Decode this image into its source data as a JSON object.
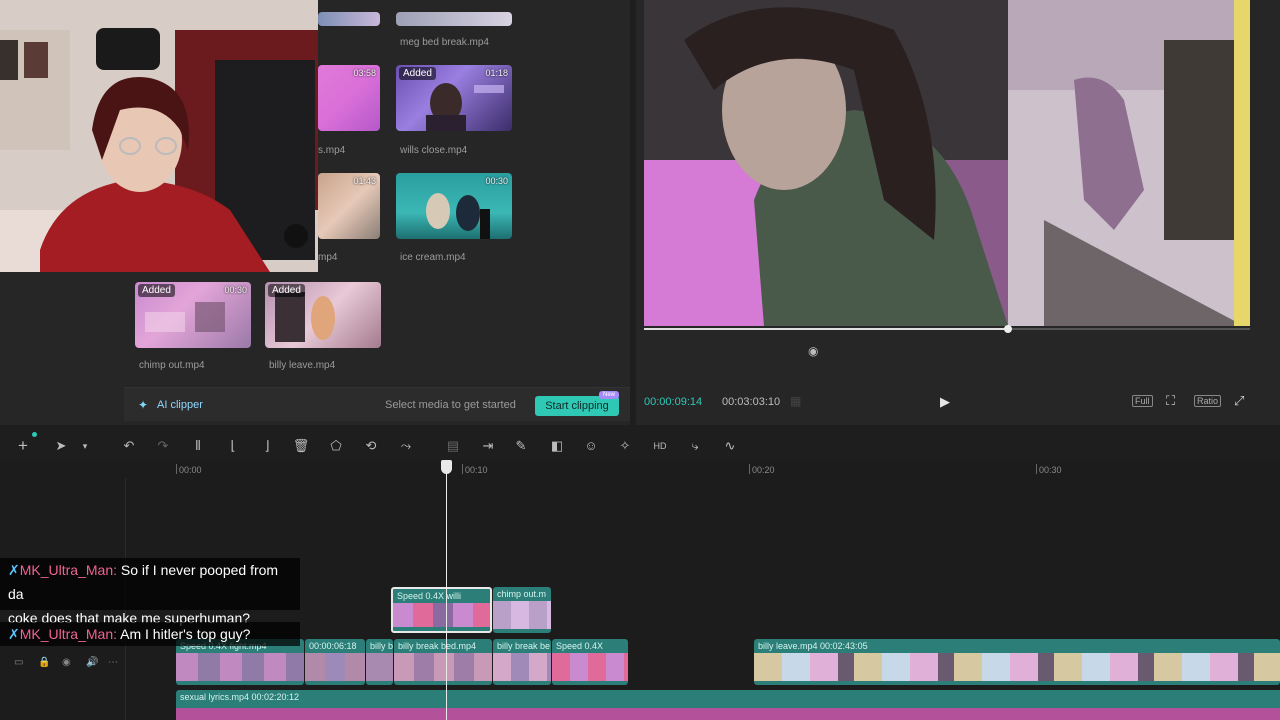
{
  "media": {
    "items": [
      {
        "name": "meg bed break.mp4",
        "added": false,
        "duration": ""
      },
      {
        "name": "s.mp4",
        "added": false,
        "duration": "03:58"
      },
      {
        "name": "wills close.mp4",
        "added": true,
        "duration": "01:18"
      },
      {
        "name": "mp4",
        "added": false,
        "duration": "01:43"
      },
      {
        "name": "ice cream.mp4",
        "added": false,
        "duration": "00:30"
      },
      {
        "name": "chimp out.mp4",
        "added": true,
        "duration": "00:30"
      },
      {
        "name": "billy leave.mp4",
        "added": true,
        "duration": ""
      }
    ],
    "added_label": "Added"
  },
  "ai_clipper": {
    "label": "AI clipper",
    "hint": "Select media to get started",
    "button": "Start clipping",
    "new_tag": "New"
  },
  "preview": {
    "current_time": "00:00:09:14",
    "total_time": "00:03:03:10",
    "full_label": "Full",
    "ratio_label": "Ratio",
    "progress": 0.6
  },
  "ruler": {
    "labels": [
      "00:00",
      "00:10",
      "00:20",
      "00:30"
    ]
  },
  "tracks": {
    "upper": [
      {
        "label": "Speed 0.4X  willi"
      },
      {
        "label": "chimp out.m"
      }
    ],
    "main": [
      {
        "label": "Speed 0.4X  fight.mp4"
      },
      {
        "label": "00:00:06:18"
      },
      {
        "label": "billy b"
      },
      {
        "label": "billy break bed.mp4"
      },
      {
        "label": "billy break be"
      },
      {
        "label": "Speed 0.4X"
      },
      {
        "label": "billy leave.mp4   00:02:43:05"
      }
    ],
    "audio": {
      "label": "sexual lyrics.mp4   00:02:20:12"
    }
  },
  "chat": {
    "messages": [
      {
        "user": "MK_Ultra_Man:",
        "text": "So if I never pooped from da",
        "text2": "coke does that make me superhuman?"
      },
      {
        "user": "MK_Ultra_Man:",
        "text": "Am I hitler's top guy?"
      }
    ]
  },
  "colors": {
    "accent": "#2fc8b5",
    "clip": "#2b7f78",
    "audio": "#b3519b",
    "chat_user": "#f06292"
  }
}
